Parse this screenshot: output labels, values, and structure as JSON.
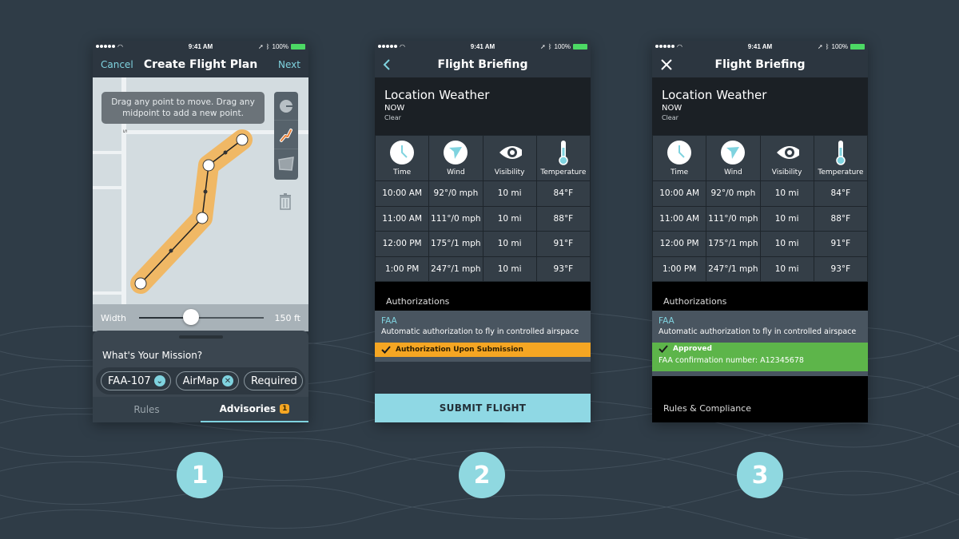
{
  "status_bar": {
    "time": "9:41 AM",
    "battery": "100%"
  },
  "steps": [
    "1",
    "2",
    "3"
  ],
  "screen1": {
    "nav": {
      "left": "Cancel",
      "title": "Create Flight Plan",
      "right": "Next"
    },
    "hint": "Drag any point to move. Drag any midpoint to add a new point.",
    "map_street_label": "S",
    "tools": [
      "circle-tool",
      "path-tool",
      "polygon-tool"
    ],
    "slider": {
      "label": "Width",
      "value": "150 ft",
      "fraction": 0.42
    },
    "mission_question": "What's Your Mission?",
    "chips": [
      {
        "label": "FAA-107",
        "icon": "chevron-down-icon",
        "glyph": "⌄"
      },
      {
        "label": "AirMap",
        "icon": "close-icon",
        "glyph": "✕"
      },
      {
        "label": "Required",
        "icon": "",
        "glyph": ""
      }
    ],
    "tabs": [
      {
        "label": "Rules",
        "active": false
      },
      {
        "label": "Advisories",
        "active": true,
        "badge": "1"
      }
    ]
  },
  "briefing": {
    "title": "Flight Briefing",
    "weather": {
      "title": "Location Weather",
      "when": "NOW",
      "condition": "Clear"
    },
    "columns": [
      "Time",
      "Wind",
      "Visibility",
      "Temperature"
    ],
    "rows": [
      [
        "10:00 AM",
        "92°/0 mph",
        "10 mi",
        "84°F"
      ],
      [
        "11:00 AM",
        "111°/0 mph",
        "10 mi",
        "88°F"
      ],
      [
        "12:00 PM",
        "175°/1 mph",
        "10 mi",
        "91°F"
      ],
      [
        "1:00 PM",
        "247°/1 mph",
        "10 mi",
        "93°F"
      ]
    ],
    "authorizations_label": "Authorizations",
    "faa": {
      "title": "FAA",
      "desc": "Automatic authorization to fly in controlled airspace"
    }
  },
  "screen2": {
    "pending_status": "Authorization Upon Submission",
    "submit_label": "SUBMIT FLIGHT",
    "colors": {
      "pending": "#f5a623",
      "submit": "#8fd8e4"
    }
  },
  "screen3": {
    "approved_status": "Approved",
    "confirmation": "FAA confirmation number: A12345678",
    "rules_label": "Rules & Compliance",
    "colors": {
      "approved": "#5db54a"
    }
  }
}
